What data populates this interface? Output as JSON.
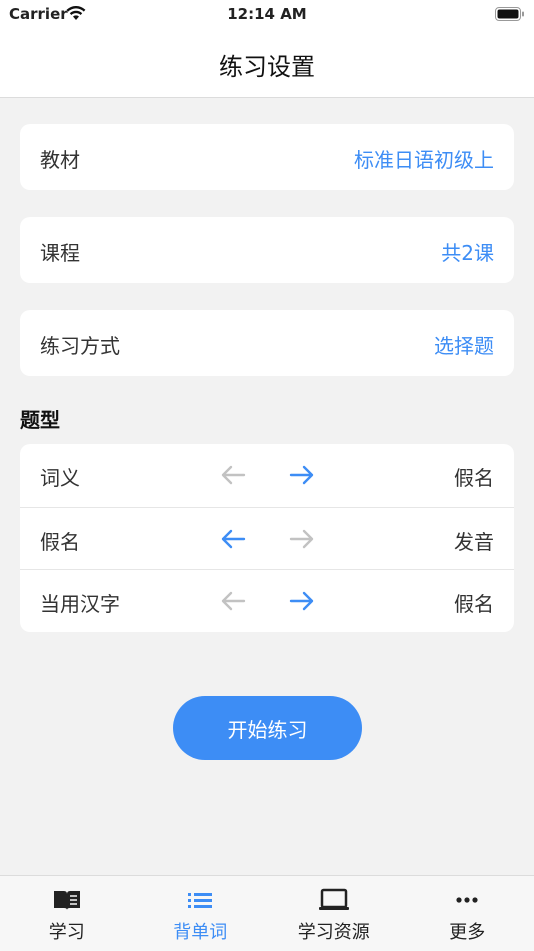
{
  "status_bar": {
    "carrier": "Carrier",
    "time": "12:14 AM"
  },
  "header": {
    "title": "练习设置"
  },
  "settings": [
    {
      "label": "教材",
      "value": "标准日语初级上"
    },
    {
      "label": "课程",
      "value": "共2课"
    },
    {
      "label": "练习方式",
      "value": "选择题"
    }
  ],
  "question_types": {
    "title": "题型",
    "rows": [
      {
        "left": "词义",
        "right": "假名",
        "active_direction": "right"
      },
      {
        "left": "假名",
        "right": "发音",
        "active_direction": "left"
      },
      {
        "left": "当用汉字",
        "right": "假名",
        "active_direction": "right"
      }
    ]
  },
  "start_button": {
    "label": "开始练习"
  },
  "tabbar": {
    "items": [
      {
        "label": "学习",
        "icon": "book-icon",
        "active": false
      },
      {
        "label": "背单词",
        "icon": "list-icon",
        "active": true
      },
      {
        "label": "学习资源",
        "icon": "laptop-icon",
        "active": false
      },
      {
        "label": "更多",
        "icon": "more-icon",
        "active": false
      }
    ]
  },
  "colors": {
    "accent": "#3d8df5",
    "inactive_arrow": "#c2c2c2",
    "background": "#f2f2f2"
  }
}
